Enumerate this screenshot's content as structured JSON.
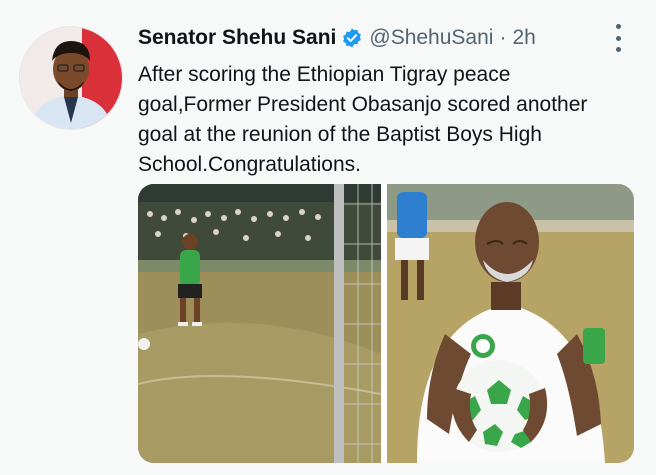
{
  "tweet": {
    "author": {
      "display_name": "Senator Shehu Sani",
      "handle": "@ShehuSani",
      "verified": true,
      "avatar_icon": "avatar-photo"
    },
    "separator": "·",
    "time": "2h",
    "more_icon": "more-options-icon",
    "text": "After scoring the Ethiopian Tigray peace\ngoal,Former President Obasanjo scored another\ngoal at the reunion of the Baptist Boys High\nSchool.Congratulations.",
    "media": [
      {
        "alt_icon": "football-match-photo"
      },
      {
        "alt_icon": "man-holding-football-photo"
      }
    ]
  },
  "colors": {
    "background": "#f7f9f9",
    "text": "#0f1419",
    "secondary_text": "#536471",
    "verified_blue": "#1d9bf0"
  }
}
